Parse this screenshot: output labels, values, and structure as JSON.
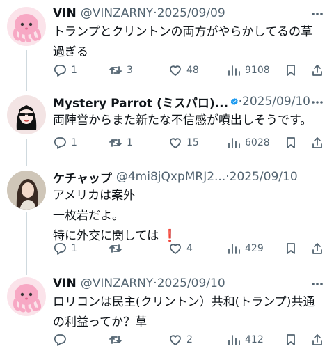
{
  "tweets": [
    {
      "name": "VIN",
      "handle": "@VINZARNY",
      "sep": "·",
      "date": "2025/09/09",
      "lines": [
        "トランプとクリントンの両方がやらかしてるの草",
        "過ぎる"
      ],
      "replies": "1",
      "retweets": "3",
      "likes": "48",
      "views": "9108",
      "avatar_icon": "pink-octopus-icon"
    },
    {
      "name": "Mystery Parrot (ミスパロ)...",
      "handle": "",
      "sep": "·",
      "date": "2025/09/10",
      "verified": true,
      "lines": [
        "両陣営からまた新たな不信感が噴出しそうです。"
      ],
      "replies": "1",
      "retweets": "1",
      "likes": "15",
      "views": "6028",
      "avatar_icon": "sunglasses-woman-illustration"
    },
    {
      "name": "ケチャップ",
      "handle": "@4mi8jQxpMRJ2...",
      "sep": "·",
      "date": "2025/09/10",
      "lines": [
        "アメリカは案外",
        "一枚岩だよ。",
        "特に外交に関しては"
      ],
      "emoji": "❗",
      "replies": "1",
      "retweets": "",
      "likes": "4",
      "views": "429",
      "avatar_icon": "woman-photo-avatar"
    },
    {
      "name": "VIN",
      "handle": "@VINZARNY",
      "sep": "·",
      "date": "2025/09/10",
      "lines": [
        "ロリコンは民主(クリントン）共和(トランプ)共通",
        "の利益ってか？草"
      ],
      "replies": "",
      "retweets": "",
      "likes": "2",
      "views": "412",
      "avatar_icon": "pink-octopus-icon"
    }
  ],
  "colors": {
    "text": "#0f1419",
    "muted": "#536471",
    "verified": "#1d9bf0",
    "emoji_red": "#d0021b",
    "octopus": "#f7a8c4"
  }
}
